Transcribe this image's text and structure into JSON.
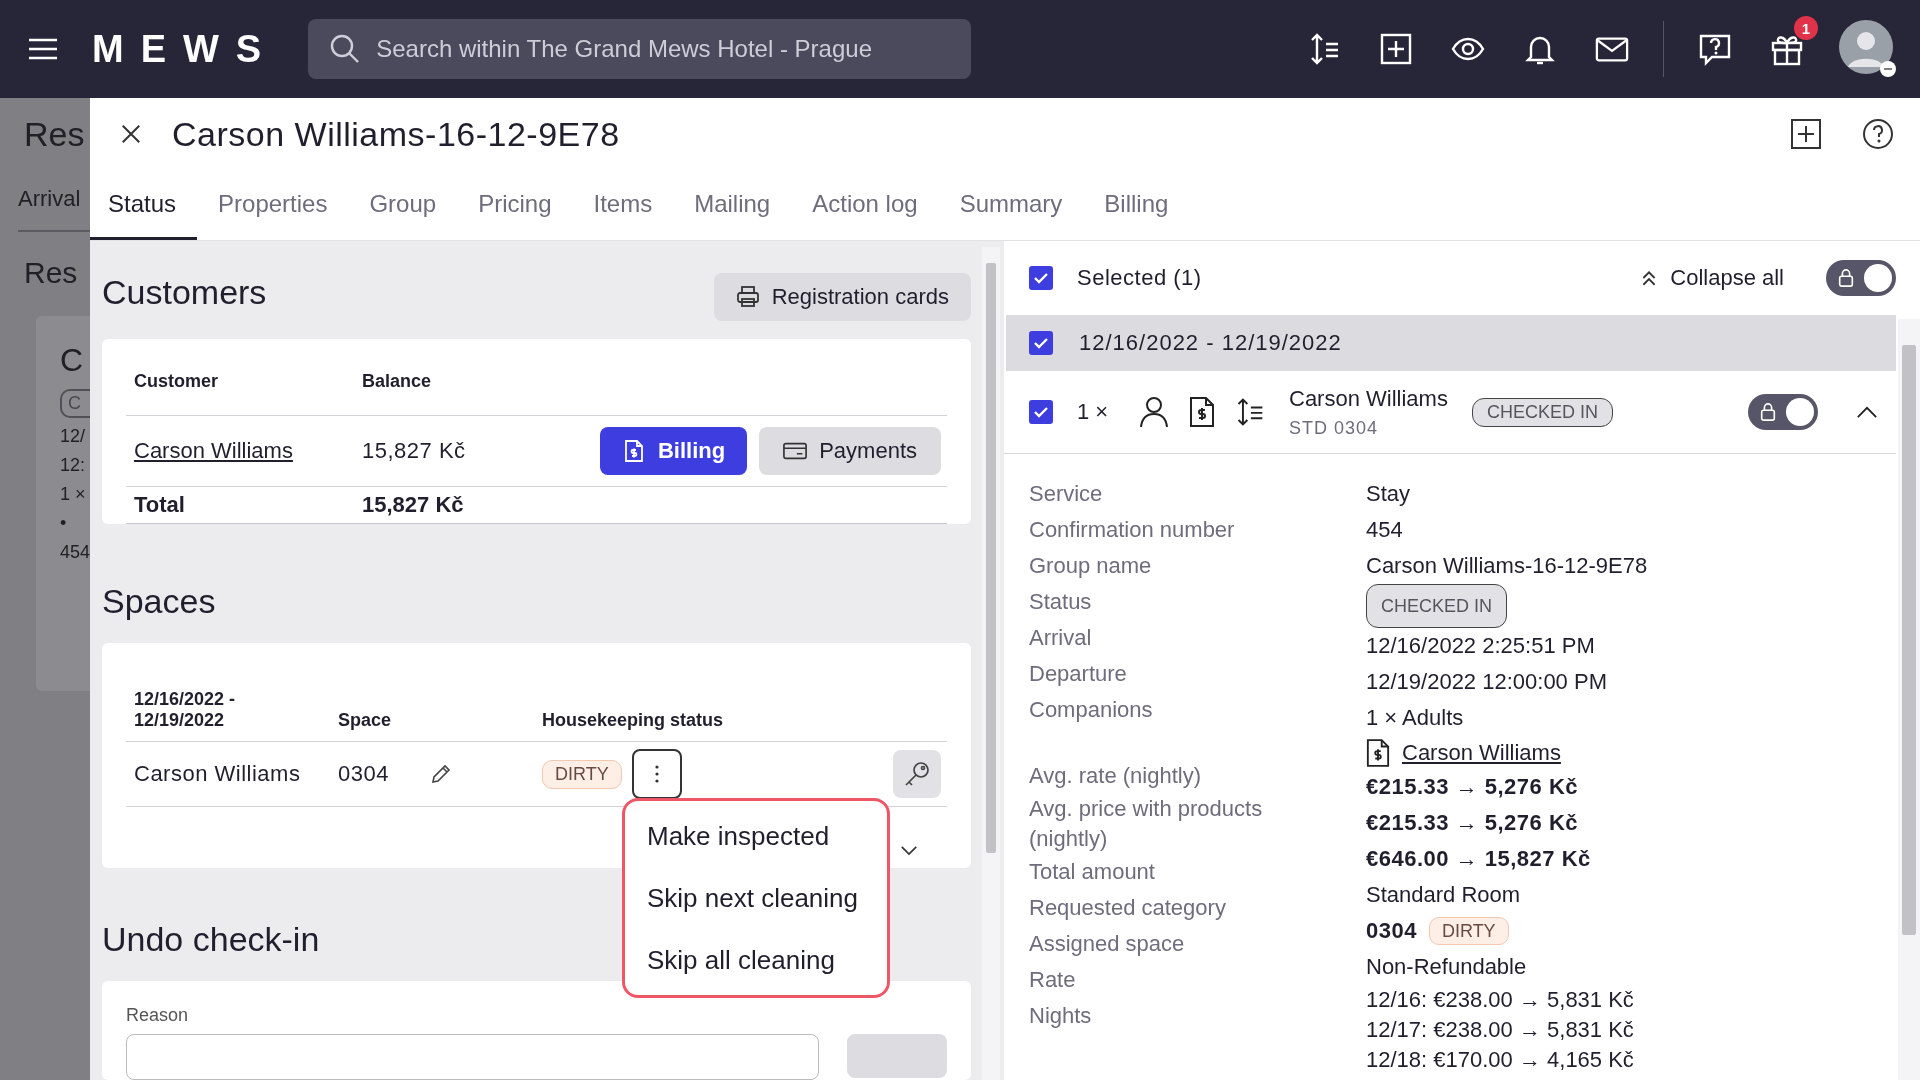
{
  "topbar": {
    "logo": "MEWS",
    "search": {
      "placeholder": "Search within The Grand Mews Hotel - Prague"
    },
    "gift_badge": "1"
  },
  "background_page": {
    "title": "Res",
    "tab": "Arrival",
    "heading": "Res",
    "card": {
      "title": "C",
      "badge": "C",
      "lines": [
        "12/",
        "12:",
        "1 ×",
        "•",
        "454"
      ]
    }
  },
  "panel": {
    "title": "Carson Williams-16-12-9E78",
    "tabs": [
      {
        "label": "Status",
        "selected": true
      },
      {
        "label": "Properties",
        "selected": false
      },
      {
        "label": "Group",
        "selected": false
      },
      {
        "label": "Pricing",
        "selected": false
      },
      {
        "label": "Items",
        "selected": false
      },
      {
        "label": "Mailing",
        "selected": false
      },
      {
        "label": "Action log",
        "selected": false
      },
      {
        "label": "Summary",
        "selected": false
      },
      {
        "label": "Billing",
        "selected": false
      }
    ]
  },
  "customers": {
    "heading": "Customers",
    "registration_button": "Registration cards",
    "columns": [
      "Customer",
      "Balance"
    ],
    "rows": [
      {
        "name": "Carson Williams",
        "balance": "15,827 Kč"
      }
    ],
    "billing_button": "Billing",
    "payments_button": "Payments",
    "total_label": "Total",
    "total_value": "15,827 Kč"
  },
  "spaces": {
    "heading": "Spaces",
    "columns": [
      "12/16/2022 - 12/19/2022",
      "Space",
      "Housekeeping status"
    ],
    "rows": [
      {
        "guest": "Carson Williams",
        "space": "0304",
        "status": "DIRTY"
      }
    ],
    "menu": {
      "items": [
        "Make inspected",
        "Skip next cleaning",
        "Skip all cleaning"
      ]
    }
  },
  "undo": {
    "heading": "Undo check-in",
    "reason_label": "Reason"
  },
  "reservation_panel": {
    "selected": {
      "checked": true,
      "label": "Selected (1)"
    },
    "collapse_all": "Collapse all",
    "lock_on": true,
    "date_group": {
      "checked": true,
      "label": "12/16/2022 - 12/19/2022"
    },
    "reservation": {
      "checked": true,
      "count": "1 ×",
      "name": "Carson Williams",
      "room": "STD 0304",
      "status": "CHECKED IN",
      "lock_on": true,
      "expanded": true
    },
    "labels": [
      {
        "text": "Service",
        "kind": "single"
      },
      {
        "text": "Confirmation number",
        "kind": "single"
      },
      {
        "text": "Group name",
        "kind": "single"
      },
      {
        "text": "Status",
        "kind": "single"
      },
      {
        "text": "Arrival",
        "kind": "single"
      },
      {
        "text": "Departure",
        "kind": "single"
      },
      {
        "text": "Companions",
        "kind": "double"
      },
      {
        "text": "Avg. rate (nightly)",
        "kind": "single"
      },
      {
        "text": "Avg. price with products (nightly)",
        "kind": "wrapped"
      },
      {
        "text": "Total amount",
        "kind": "single"
      },
      {
        "text": "Requested category",
        "kind": "single"
      },
      {
        "text": "Assigned space",
        "kind": "single"
      },
      {
        "text": "Rate",
        "kind": "single"
      },
      {
        "text": "Nights",
        "kind": "single"
      }
    ],
    "values": [
      {
        "kind": "text",
        "text": "Stay"
      },
      {
        "kind": "text",
        "text": "454"
      },
      {
        "kind": "text",
        "text": "Carson Williams-16-12-9E78"
      },
      {
        "kind": "badge",
        "text": "CHECKED IN"
      },
      {
        "kind": "text",
        "text": "12/16/2022 2:25:51 PM"
      },
      {
        "kind": "text",
        "text": "12/19/2022 12:00:00 PM"
      },
      {
        "kind": "text",
        "text": "1 × Adults"
      },
      {
        "kind": "link",
        "text": "Carson Williams"
      },
      {
        "kind": "bold",
        "text": "€215.33 → 5,276 Kč"
      },
      {
        "kind": "bold",
        "text": "€215.33 → 5,276 Kč"
      },
      {
        "kind": "bold",
        "text": "€646.00 → 15,827 Kč"
      },
      {
        "kind": "text",
        "text": "Standard Room"
      },
      {
        "kind": "space",
        "text": "0304",
        "badge": "DIRTY"
      },
      {
        "kind": "text",
        "text": "Non-Refundable"
      },
      {
        "kind": "night",
        "text": "12/16: €238.00 → 5,831 Kč"
      },
      {
        "kind": "night",
        "text": "12/17: €238.00 → 5,831 Kč"
      },
      {
        "kind": "night",
        "text": "12/18: €170.00 → 4,165 Kč"
      }
    ]
  }
}
